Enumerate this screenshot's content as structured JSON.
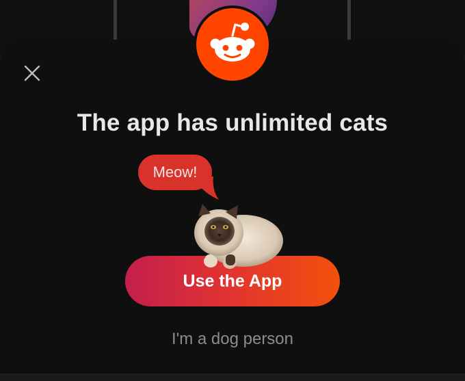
{
  "modal": {
    "title": "The app has unlimited cats",
    "bubble_text": "Meow!",
    "cta_label": "Use the App",
    "secondary_label": "I'm a dog person",
    "close_icon": "close-icon",
    "logo_icon": "reddit-snoo-icon"
  },
  "colors": {
    "brand": "#ff4500",
    "bubble": "#d8322a",
    "cta_start": "#c41e4e",
    "cta_end": "#f2510c",
    "sheet_bg": "#0f0f0f",
    "title_text": "#e8e8e8",
    "secondary_text": "#8c8c8c"
  }
}
